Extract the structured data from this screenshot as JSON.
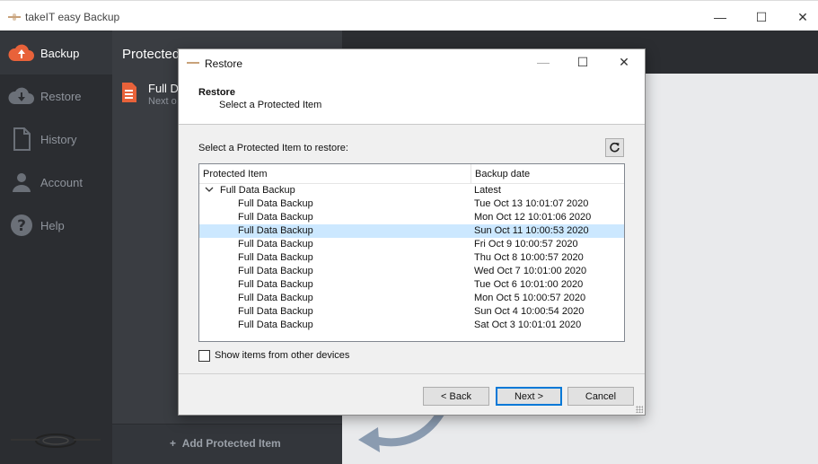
{
  "window": {
    "title": "takeIT easy Backup"
  },
  "nav": {
    "items": [
      {
        "label": "Backup",
        "icon": "cloud-upload-icon",
        "active": true
      },
      {
        "label": "Restore",
        "icon": "cloud-download-icon",
        "active": false
      },
      {
        "label": "History",
        "icon": "document-icon",
        "active": false
      },
      {
        "label": "Account",
        "icon": "user-icon",
        "active": false
      },
      {
        "label": "Help",
        "icon": "help-icon",
        "active": false
      }
    ]
  },
  "protected": {
    "header": "Protected I",
    "item_name": "Full Da",
    "item_sub": "Next o",
    "add_label": "Add Protected Item"
  },
  "dialog": {
    "title": "Restore",
    "header_title": "Restore",
    "header_subtitle": "Select a Protected Item",
    "prompt": "Select a Protected Item to restore:",
    "columns": [
      "Protected Item",
      "Backup date"
    ],
    "parent": {
      "name": "Full Data Backup",
      "date": "Latest"
    },
    "rows": [
      {
        "name": "Full Data Backup",
        "date": "Tue Oct 13 10:01:07 2020",
        "selected": false
      },
      {
        "name": "Full Data Backup",
        "date": "Mon Oct 12 10:01:06 2020",
        "selected": false
      },
      {
        "name": "Full Data Backup",
        "date": "Sun Oct 11 10:00:53 2020",
        "selected": true
      },
      {
        "name": "Full Data Backup",
        "date": "Fri Oct 9 10:00:57 2020",
        "selected": false
      },
      {
        "name": "Full Data Backup",
        "date": "Thu Oct 8 10:00:57 2020",
        "selected": false
      },
      {
        "name": "Full Data Backup",
        "date": "Wed Oct 7 10:01:00 2020",
        "selected": false
      },
      {
        "name": "Full Data Backup",
        "date": "Tue Oct 6 10:01:00 2020",
        "selected": false
      },
      {
        "name": "Full Data Backup",
        "date": "Mon Oct 5 10:00:57 2020",
        "selected": false
      },
      {
        "name": "Full Data Backup",
        "date": "Sun Oct 4 10:00:54 2020",
        "selected": false
      },
      {
        "name": "Full Data Backup",
        "date": "Sat Oct 3 10:01:01 2020",
        "selected": false
      }
    ],
    "checkbox_label": "Show items from other devices",
    "checkbox_checked": false,
    "buttons": {
      "back": "< Back",
      "next": "Next >",
      "cancel": "Cancel"
    }
  },
  "colors": {
    "nav_bg": "#2b2d31",
    "column_bg": "#3a3d42",
    "accent": "#0078d7",
    "selection": "#cce8ff",
    "backup_icon": "#e8623a"
  }
}
